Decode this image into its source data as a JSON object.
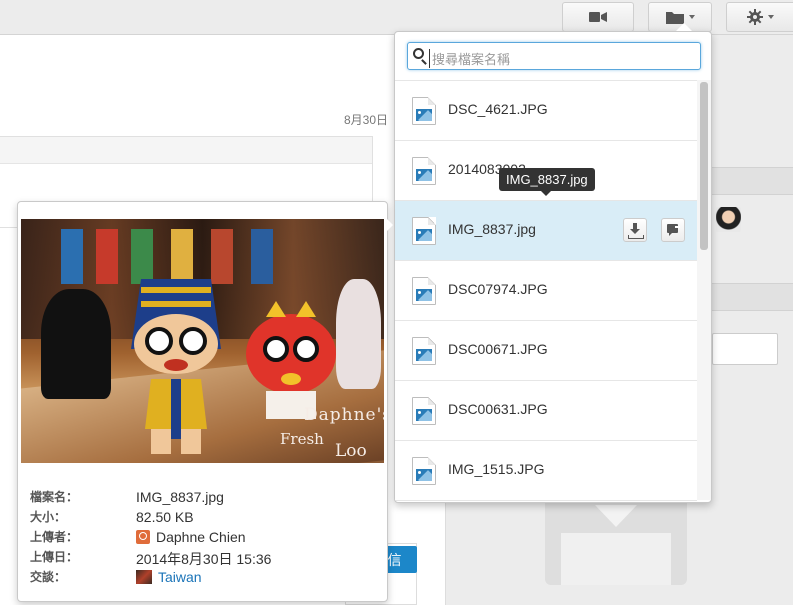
{
  "date_label": "8月30日",
  "toolbar": {
    "video_icon": "video-camera-icon",
    "folder_icon": "folder-icon",
    "settings_icon": "gear-icon"
  },
  "file_menu": {
    "search_placeholder": "搜尋檔案名稱",
    "files": [
      {
        "name": "DSC_4621.JPG"
      },
      {
        "name": "2014083002..."
      },
      {
        "name": "IMG_8837.jpg",
        "active": true
      },
      {
        "name": "DSC07974.JPG"
      },
      {
        "name": "DSC00671.JPG"
      },
      {
        "name": "DSC00631.JPG"
      },
      {
        "name": "IMG_1515.JPG"
      }
    ],
    "tooltip": "IMG_8837.jpg"
  },
  "preview": {
    "watermark_line1": "Daphne's",
    "watermark_line2": "Fresh",
    "watermark_line3": "Loo",
    "labels": {
      "filename": "檔案名：",
      "size": "大小：",
      "uploader": "上傳者：",
      "upload_date": "上傳日：",
      "chat": "交談："
    },
    "values": {
      "filename": "IMG_8837.jpg",
      "size": "82.50 KB",
      "uploader": "Daphne Chien",
      "upload_date": "2014年8月30日 15:36",
      "chat": "Taiwan"
    }
  },
  "send_button": "信",
  "colors": {
    "accent": "#1c87c9",
    "active_row": "#d9edf7",
    "tooltip_bg": "#333333"
  }
}
